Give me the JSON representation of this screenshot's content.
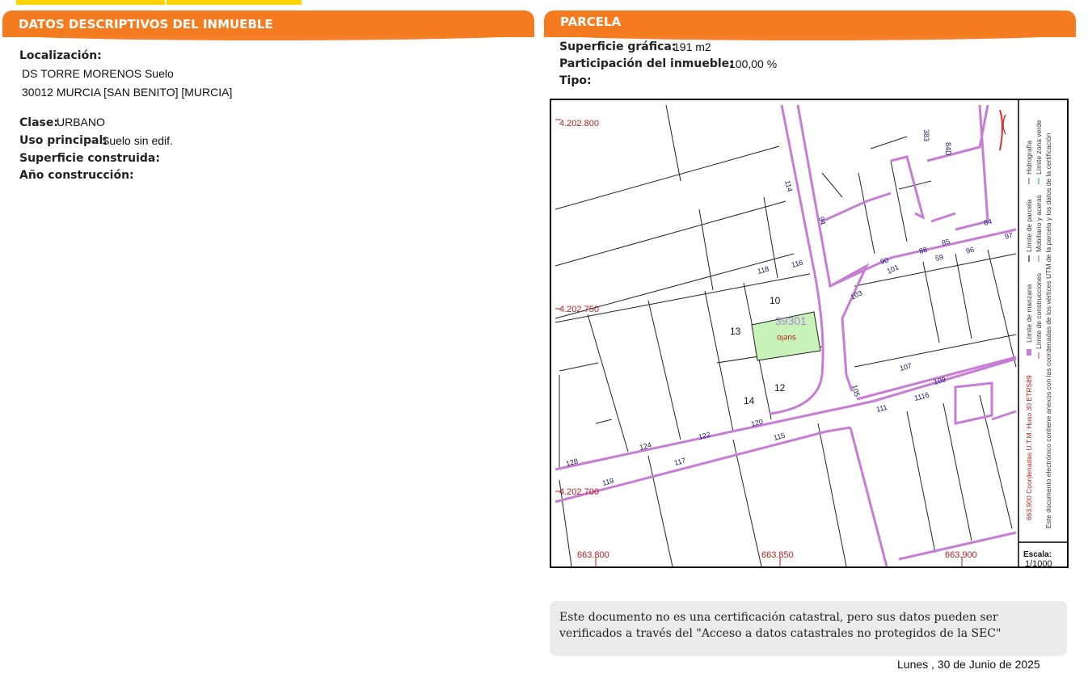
{
  "left_panel": {
    "title": "DATOS DESCRIPTIVOS DEL INMUEBLE",
    "localizacion_label": "Localización:",
    "address_line1": "DS TORRE MORENOS  Suelo",
    "address_line2": "30012 MURCIA [SAN BENITO] [MURCIA]",
    "clase_label": "Clase:",
    "clase_value": "URBANO",
    "uso_label": "Uso principal:",
    "uso_value": "Suelo sin edif.",
    "superficie_construida_label": "Superficie construida:",
    "anio_label": "Año construcción:"
  },
  "right_panel": {
    "title": "PARCELA",
    "superficie_grafica_label": "Superficie gráfica:",
    "superficie_grafica_value": "191 m2",
    "participacion_label": "Participación del inmueble:",
    "participacion_value": "100,00 %",
    "tipo_label": "Tipo:"
  },
  "map": {
    "parcel_ref": "39301",
    "parcel_label": "suelo",
    "y_coords": [
      "4.202.800",
      "4.202.750",
      "4.202.700"
    ],
    "x_coords": [
      "663.800",
      "663.850",
      "663.900"
    ],
    "block_numbers": [
      "10",
      "13",
      "12",
      "14"
    ],
    "street_numbers": [
      "114",
      "94",
      "118",
      "116",
      "90",
      "88",
      "85",
      "84",
      "59",
      "96",
      "97",
      "101",
      "103",
      "105",
      "107",
      "109",
      "111",
      "1116",
      "128",
      "124",
      "122",
      "120",
      "115",
      "117",
      "119",
      "383",
      "84D"
    ],
    "legend_line1": "663.900 Coordenadas U.T.M. Huso 30 ETRS89",
    "legend_line2a": "Límite de manzana",
    "legend_line2b": "Límite de parcela",
    "legend_line2c": "Hidrografía",
    "legend_line3a": "Límite de construcciones",
    "legend_line3b": "Mobiliario y aceras",
    "legend_line3c": "Límite zona verde",
    "legend_line4": "Este documento electrónico contiene anexos con las coordenadas de los vértices UTM de la parcela y los datos de la certificación",
    "scale_label": "Escala:",
    "scale_value": "1/1000",
    "colors": {
      "block_line": "#c77dd6",
      "coord_text": "#b22222",
      "parcel_fill": "#c9f2b8",
      "ref_text": "#a78bd8"
    }
  },
  "note": "Este documento no es una certificación catastral, pero sus datos pueden ser verificados a través del \"Acceso a datos catastrales no protegidos de la SEC\"",
  "date": "Lunes , 30 de Junio de 2025"
}
